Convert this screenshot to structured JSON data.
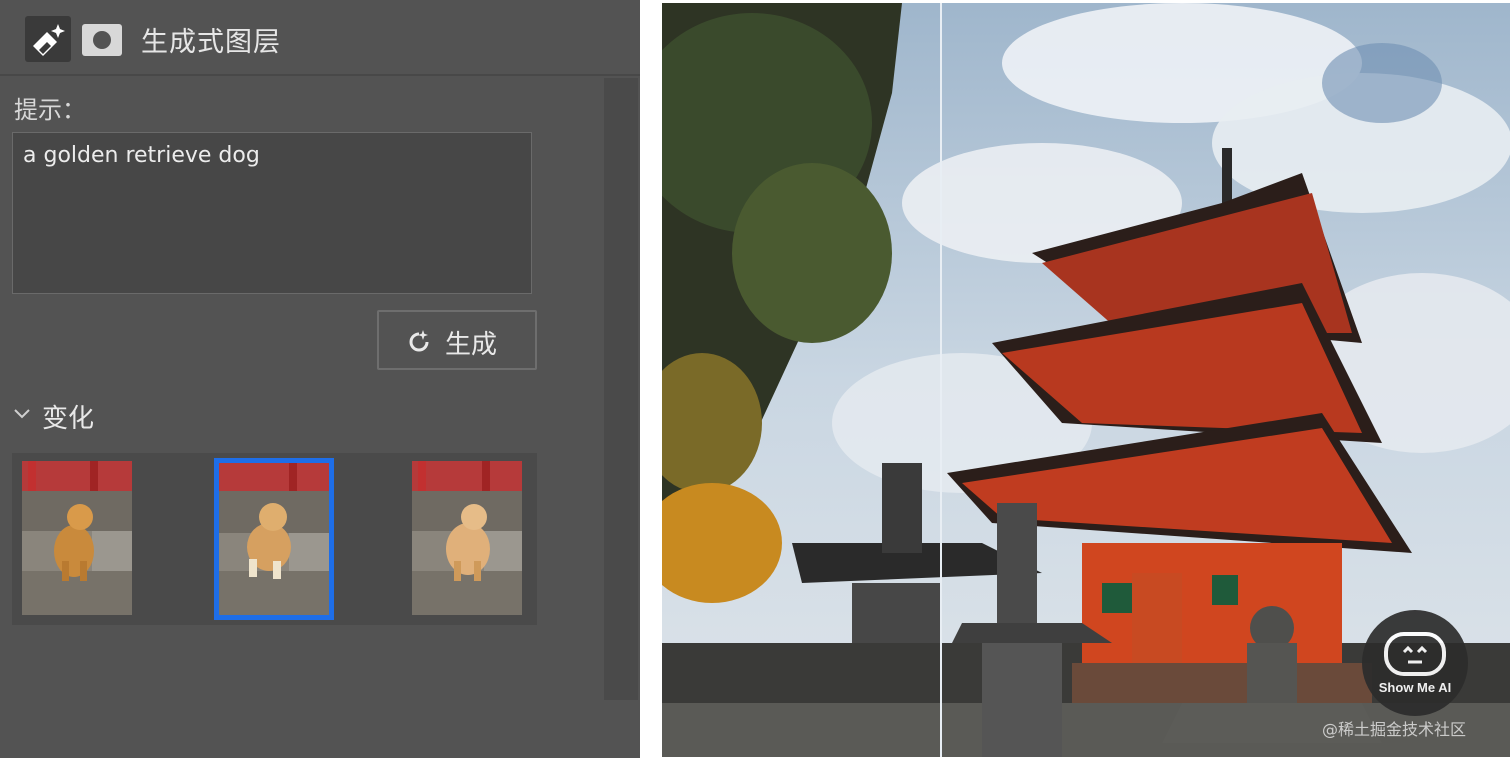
{
  "panel": {
    "title": "生成式图层",
    "prompt_label": "提示：",
    "prompt_value": "a golden retrieve dog",
    "generate_label": "生成",
    "variations_label": "变化",
    "variations": [
      {
        "name": "variation-1",
        "selected": false
      },
      {
        "name": "variation-2",
        "selected": true
      },
      {
        "name": "variation-3",
        "selected": false
      }
    ]
  },
  "photo": {
    "badge_text": "Show Me AI",
    "watermark": "@稀土掘金技术社区"
  },
  "colors": {
    "panel_bg": "#535353",
    "selection_accent": "#1e6ee8",
    "pagoda_red": "#c8341c"
  }
}
